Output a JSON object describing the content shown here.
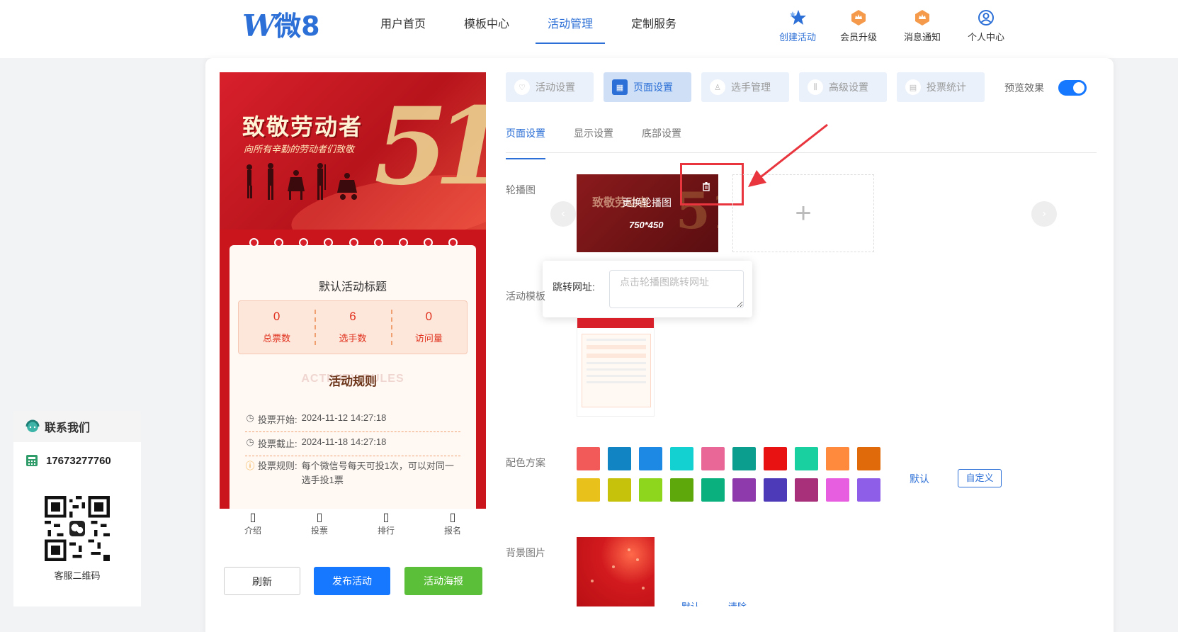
{
  "header": {
    "logo_mark": "W",
    "logo_text": "微8",
    "nav": [
      "用户首页",
      "模板中心",
      "活动管理",
      "定制服务"
    ],
    "active_nav": "活动管理",
    "quick_links": [
      {
        "label": "创建活动",
        "icon": "star-icon"
      },
      {
        "label": "会员升级",
        "icon": "crown-icon"
      },
      {
        "label": "消息通知",
        "icon": "crown-icon"
      },
      {
        "label": "个人中心",
        "icon": "user-icon"
      }
    ]
  },
  "preview": {
    "banner_title": "致敬劳动者",
    "banner_subtitle": "向所有辛勤的劳动者们致敬",
    "banner_number": "51",
    "activity_title": "默认活动标题",
    "stats": [
      {
        "value": "0",
        "label": "总票数"
      },
      {
        "value": "6",
        "label": "选手数"
      },
      {
        "value": "0",
        "label": "访问量"
      }
    ],
    "rules_ghost": "ACTIVITY RULES",
    "rules_title": "活动规则",
    "vote_start_label": "投票开始:",
    "vote_start": "2024-11-12 14:27:18",
    "vote_end_label": "投票截止:",
    "vote_end": "2024-11-18 14:27:18",
    "vote_rule_label": "投票规则:",
    "vote_rule": "每个微信号每天可投1次，可以对同一选手投1票",
    "tabs": [
      "介绍",
      "投票",
      "排行",
      "报名"
    ]
  },
  "actions": {
    "refresh": "刷新",
    "publish": "发布活动",
    "poster": "活动海报"
  },
  "contact": {
    "title": "联系我们",
    "phone": "17673277760",
    "qr_label": "客服二维码"
  },
  "settings": {
    "steps": [
      "活动设置",
      "页面设置",
      "选手管理",
      "高级设置",
      "投票统计"
    ],
    "active_step": "页面设置",
    "preview_label": "预览效果",
    "preview_enabled": true,
    "sub_tabs": [
      "页面设置",
      "显示设置",
      "底部设置"
    ],
    "active_sub_tab": "页面设置",
    "carousel_label": "轮播图",
    "carousel_replace": "更换轮播图",
    "carousel_size": "750*450",
    "jump_url_label": "跳转网址:",
    "jump_url_placeholder": "点击轮播图跳转网址",
    "template_label": "活动模板",
    "color_label": "配色方案",
    "colors": [
      "#f25a5a",
      "#1185c3",
      "#1e88e5",
      "#14d1d1",
      "#e86796",
      "#0b9e8f",
      "#e81212",
      "#19d1a0",
      "#ff8a3d",
      "#e06a0a",
      "#e8c21a",
      "#c6c20c",
      "#8ed61d",
      "#5fa80b",
      "#0bb07f",
      "#8e3aad",
      "#4c3ab8",
      "#a8307a",
      "#e85ee0",
      "#8f5ee8"
    ],
    "color_default": "默认",
    "color_custom": "自定义",
    "bg_label": "背景图片",
    "bg_default": "默认",
    "bg_clear": "清除"
  }
}
